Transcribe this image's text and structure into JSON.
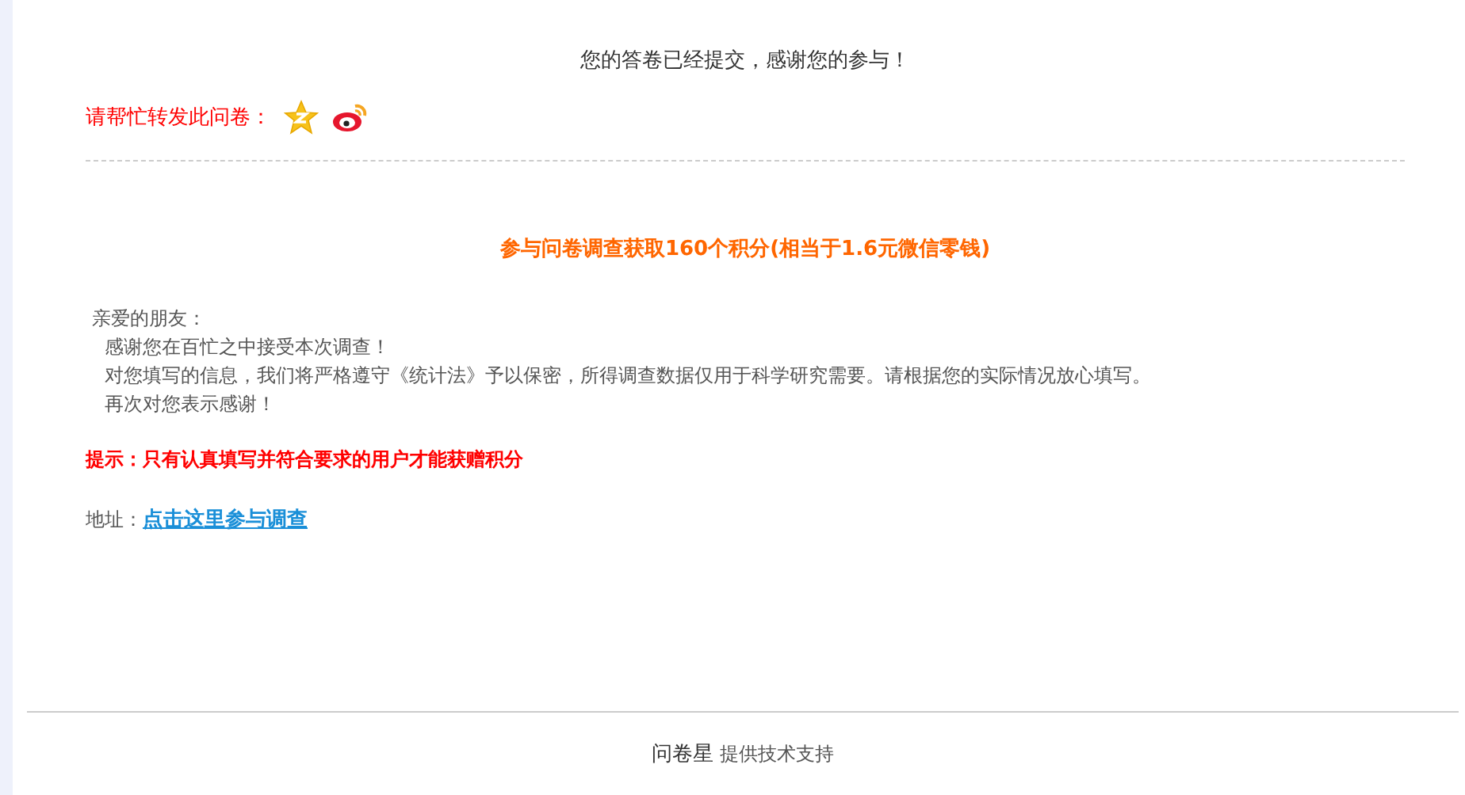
{
  "message": "您的答卷已经提交，感谢您的参与！",
  "share": {
    "label": "请帮忙转发此问卷："
  },
  "reward_title": "参与问卷调查获取160个积分(相当于1.6元微信零钱)",
  "letter": [
    "亲爱的朋友：",
    "感谢您在百忙之中接受本次调查！",
    "对您填写的信息，我们将严格遵守《统计法》予以保密，所得调查数据仅用于科学研究需要。请根据您的实际情况放心填写。",
    "再次对您表示感谢！"
  ],
  "tip": "提示：只有认真填写并符合要求的用户才能获赠积分",
  "address": {
    "label": "地址：",
    "link": "点击这里参与调查"
  },
  "footer": {
    "brand": "问卷星",
    "text": "提供技术支持"
  }
}
